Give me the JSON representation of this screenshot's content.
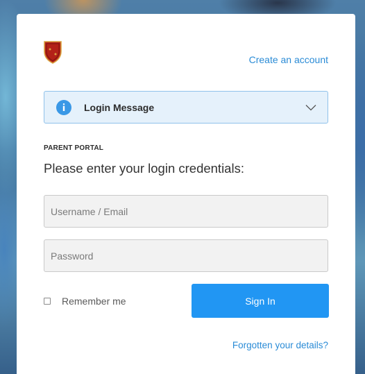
{
  "header": {
    "create_account_label": "Create an account"
  },
  "login_message": {
    "label": "Login Message"
  },
  "form": {
    "section_label": "PARENT PORTAL",
    "heading": "Please enter your login credentials:",
    "username_placeholder": "Username / Email",
    "username_value": "",
    "password_placeholder": "Password",
    "password_value": "",
    "remember_label": "Remember me",
    "remember_checked": false,
    "signin_label": "Sign In",
    "forgot_label": "Forgotten your details?"
  },
  "icons": {
    "crest": "school-crest-logo",
    "info": "info-icon",
    "chevron": "chevron-down-icon"
  },
  "colors": {
    "accent": "#2196f3",
    "link": "#2a8bd6",
    "message_bg": "#e5f1fb",
    "message_border": "#8fc1ea",
    "crest_red": "#b32218",
    "crest_gold": "#d9a441"
  }
}
